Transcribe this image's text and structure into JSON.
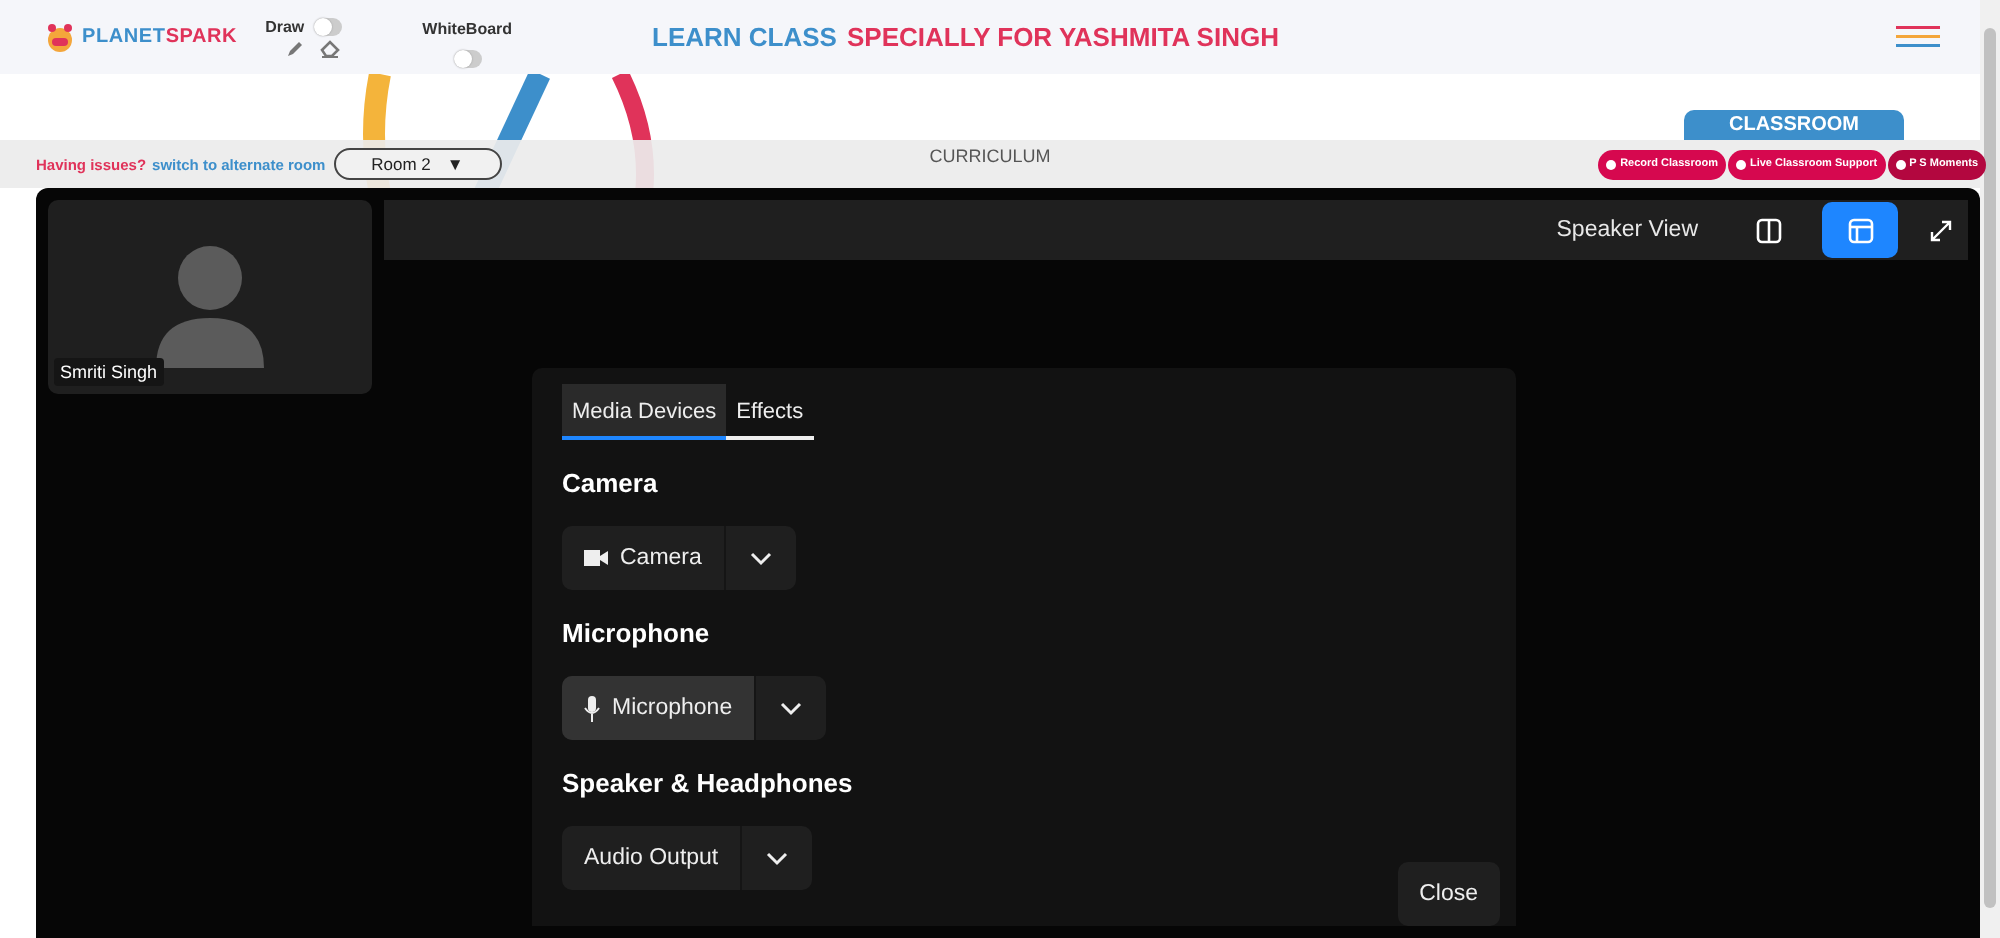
{
  "header": {
    "logo": {
      "part_1": "PLANET",
      "part_2": "SPARK"
    },
    "draw": {
      "label": "Draw",
      "on": false
    },
    "whiteboard": {
      "label": "WhiteBoard",
      "on": false
    },
    "title": {
      "part_1": "LEARN CLASS",
      "part_2": "SPECIALLY FOR YASHMITA SINGH"
    }
  },
  "classroom_tab": "CLASSROOM",
  "bar": {
    "issue_text": "Having issues?",
    "switch_link": "switch to alternate room",
    "room_select": "Room 2",
    "room_caret": "▼",
    "curriculum": "CURRICULUM",
    "actions": [
      "Record Classroom",
      "Live Classroom Support",
      "P S Moments"
    ]
  },
  "participant": {
    "name": "Smriti Singh"
  },
  "toolbar": {
    "view_label": "Speaker View",
    "layouts": [
      {
        "kind": "split",
        "selected": false
      },
      {
        "kind": "speaker",
        "selected": true
      }
    ]
  },
  "dialog": {
    "tabs": [
      {
        "label": "Media Devices",
        "selected": true
      },
      {
        "label": "Effects",
        "selected": false
      }
    ],
    "sections": [
      {
        "heading": "Camera",
        "device": "Camera",
        "kind": "camera",
        "selected": false
      },
      {
        "heading": "Microphone",
        "device": "Microphone",
        "kind": "microphone",
        "selected": true
      },
      {
        "heading": "Speaker & Headphones",
        "device": "Audio Output",
        "kind": "none",
        "selected": false
      }
    ],
    "close": "Close"
  }
}
